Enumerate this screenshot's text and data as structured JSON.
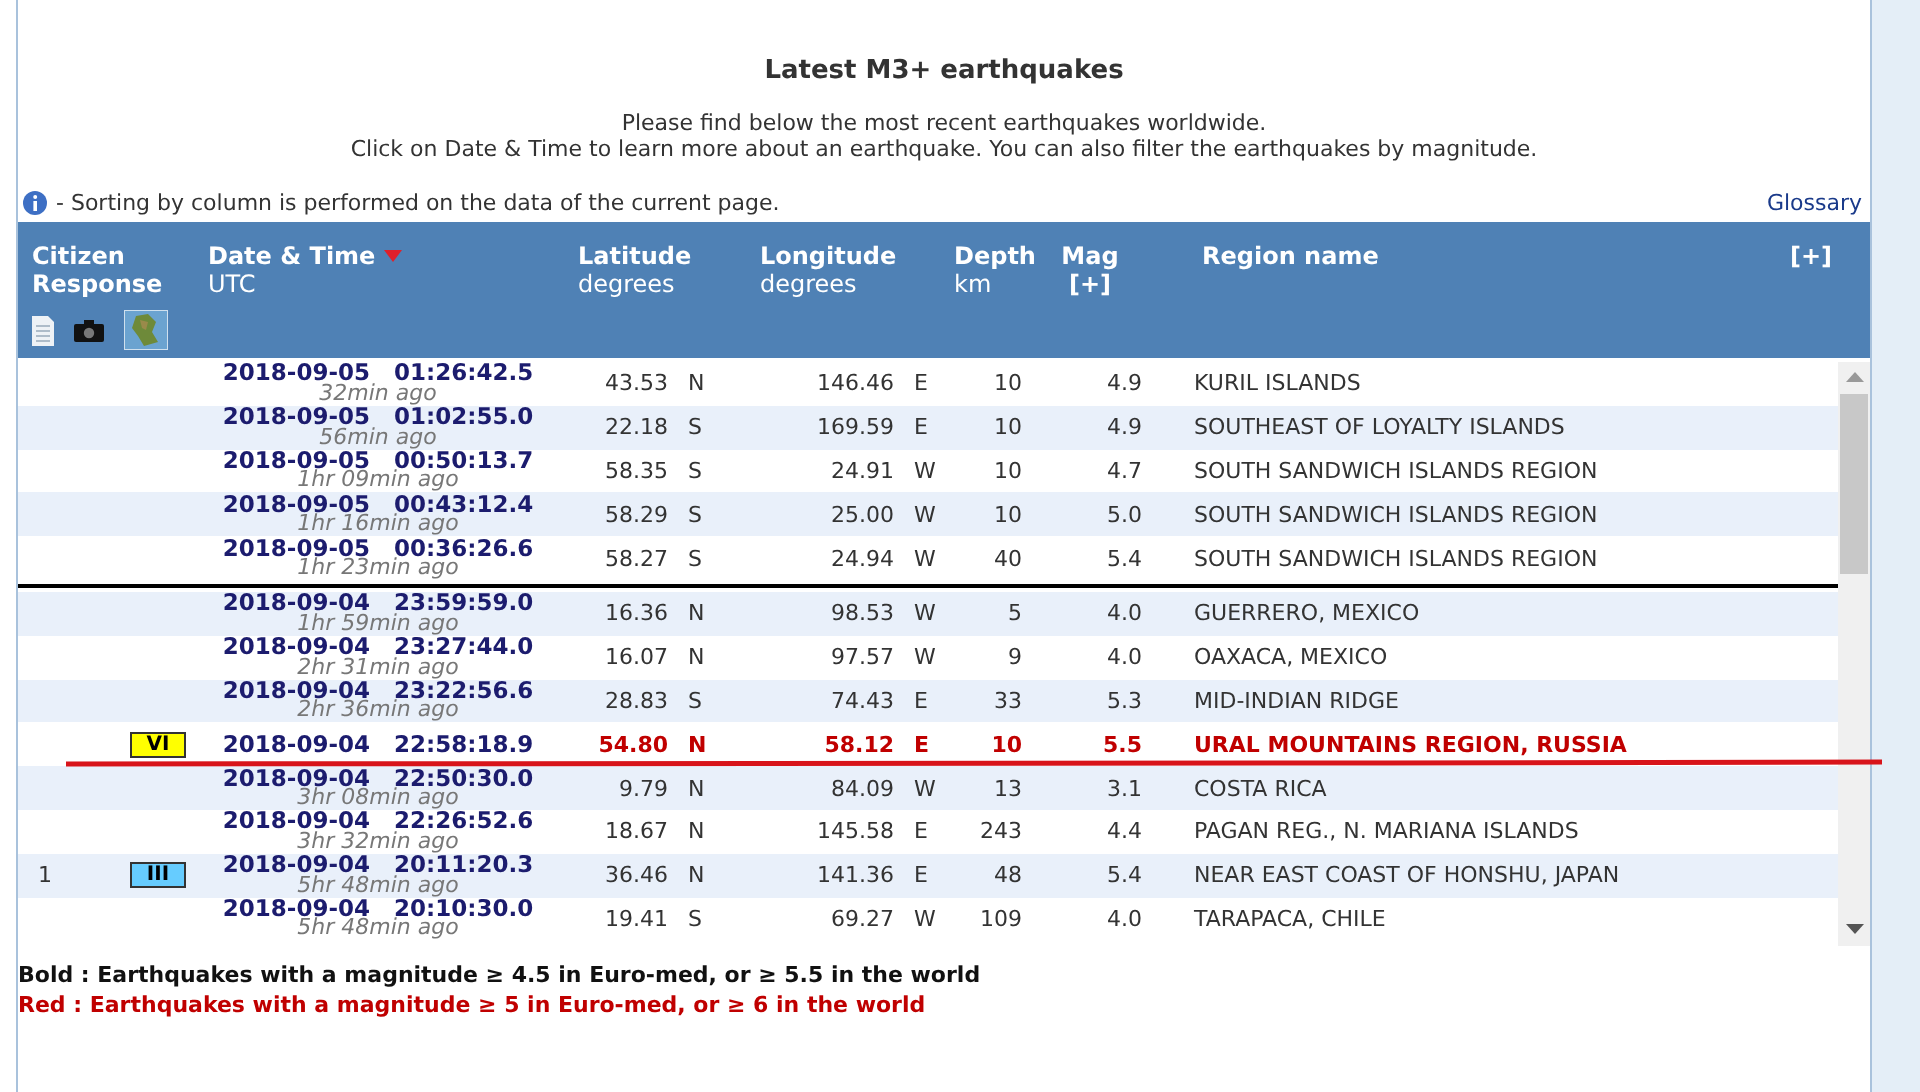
{
  "title": "Latest M3+ earthquakes",
  "intro": [
    "Please find below the most recent earthquakes worldwide.",
    "Click on Date & Time to learn more about an earthquake. You can also filter the earthquakes by magnitude."
  ],
  "info_note": "- Sorting by column is performed on the data of the current page.",
  "glossary_link": "Glossary",
  "table": {
    "columns": [
      {
        "title": "Citizen Response"
      },
      {
        "title": "Date & Time",
        "subtitle": "UTC",
        "sorted": true
      },
      {
        "title": "Latitude",
        "subtitle": "degrees"
      },
      {
        "title": "Longitude",
        "subtitle": "degrees"
      },
      {
        "title": "Depth",
        "subtitle": "km"
      },
      {
        "title": "Mag",
        "subtitle": "[+]"
      },
      {
        "title": "Region name"
      }
    ],
    "expand_label": "[+]",
    "groups": [
      [
        {
          "kind": "normal",
          "datetime": "2018-09-05   01:26:42.5",
          "ago": "32min ago",
          "lat": "43.53",
          "lat_dir": "N",
          "lon": "146.46",
          "lon_dir": "E",
          "depth": "10",
          "mag": "4.9",
          "region": "KURIL ISLANDS"
        },
        {
          "kind": "normal",
          "datetime": "2018-09-05   01:02:55.0",
          "ago": "56min ago",
          "lat": "22.18",
          "lat_dir": "S",
          "lon": "169.59",
          "lon_dir": "E",
          "depth": "10",
          "mag": "4.9",
          "region": "SOUTHEAST OF LOYALTY ISLANDS"
        },
        {
          "kind": "normal",
          "datetime": "2018-09-05   00:50:13.7",
          "ago": "1hr 09min ago",
          "lat": "58.35",
          "lat_dir": "S",
          "lon": "24.91",
          "lon_dir": "W",
          "depth": "10",
          "mag": "4.7",
          "region": "SOUTH SANDWICH ISLANDS REGION"
        },
        {
          "kind": "normal",
          "datetime": "2018-09-05   00:43:12.4",
          "ago": "1hr 16min ago",
          "lat": "58.29",
          "lat_dir": "S",
          "lon": "25.00",
          "lon_dir": "W",
          "depth": "10",
          "mag": "5.0",
          "region": "SOUTH SANDWICH ISLANDS REGION"
        },
        {
          "kind": "normal",
          "datetime": "2018-09-05   00:36:26.6",
          "ago": "1hr 23min ago",
          "lat": "58.27",
          "lat_dir": "S",
          "lon": "24.94",
          "lon_dir": "W",
          "depth": "40",
          "mag": "5.4",
          "region": "SOUTH SANDWICH ISLANDS REGION"
        }
      ],
      [
        {
          "kind": "normal",
          "datetime": "2018-09-04   23:59:59.0",
          "ago": "1hr 59min ago",
          "lat": "16.36",
          "lat_dir": "N",
          "lon": "98.53",
          "lon_dir": "W",
          "depth": "5",
          "mag": "4.0",
          "region": "GUERRERO, MEXICO"
        },
        {
          "kind": "normal",
          "datetime": "2018-09-04   23:27:44.0",
          "ago": "2hr 31min ago",
          "lat": "16.07",
          "lat_dir": "N",
          "lon": "97.57",
          "lon_dir": "W",
          "depth": "9",
          "mag": "4.0",
          "region": "OAXACA, MEXICO"
        },
        {
          "kind": "normal",
          "datetime": "2018-09-04   23:22:56.6",
          "ago": "2hr 36min ago",
          "lat": "28.83",
          "lat_dir": "S",
          "lon": "74.43",
          "lon_dir": "E",
          "depth": "33",
          "mag": "5.3",
          "region": "MID-INDIAN RIDGE"
        },
        {
          "kind": "red",
          "intensity": {
            "text": "VI",
            "color": "#ffff00"
          },
          "datetime": "2018-09-04   22:58:18.9",
          "lat": "54.80",
          "lat_dir": "N",
          "lon": "58.12",
          "lon_dir": "E",
          "depth": "10",
          "mag": "5.5",
          "region": "URAL MOUNTAINS REGION, RUSSIA"
        },
        {
          "kind": "normal",
          "datetime": "2018-09-04   22:50:30.0",
          "ago": "3hr 08min ago",
          "lat": "9.79",
          "lat_dir": "N",
          "lon": "84.09",
          "lon_dir": "W",
          "depth": "13",
          "mag": "3.1",
          "region": "COSTA RICA"
        },
        {
          "kind": "normal",
          "datetime": "2018-09-04   22:26:52.6",
          "ago": "3hr 32min ago",
          "lat": "18.67",
          "lat_dir": "N",
          "lon": "145.58",
          "lon_dir": "E",
          "depth": "243",
          "mag": "4.4",
          "region": "PAGAN REG., N. MARIANA ISLANDS"
        },
        {
          "kind": "normal",
          "citizen_count": "1",
          "intensity": {
            "text": "III",
            "color": "#66ccff"
          },
          "datetime": "2018-09-04   20:11:20.3",
          "ago": "5hr 48min ago",
          "lat": "36.46",
          "lat_dir": "N",
          "lon": "141.36",
          "lon_dir": "E",
          "depth": "48",
          "mag": "5.4",
          "region": "NEAR EAST COAST OF HONSHU, JAPAN"
        },
        {
          "kind": "normal",
          "datetime": "2018-09-04   20:10:30.0",
          "ago": "5hr 48min ago",
          "lat": "19.41",
          "lat_dir": "S",
          "lon": "69.27",
          "lon_dir": "W",
          "depth": "109",
          "mag": "4.0",
          "region": "TARAPACA, CHILE"
        }
      ]
    ]
  },
  "legend": [
    {
      "kind": "bold",
      "text": "Bold : Earthquakes with a magnitude ≥ 4.5 in Euro-med, or ≥ 5.5 in the world"
    },
    {
      "kind": "red",
      "text": "Red : Earthquakes with a magnitude ≥ 5 in Euro-med, or ≥ 6 in the world"
    }
  ]
}
